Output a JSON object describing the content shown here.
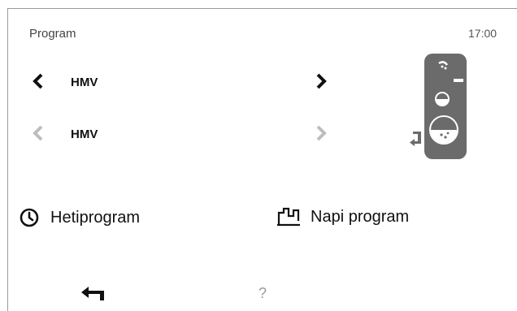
{
  "header": {
    "title": "Program",
    "time": "17:00"
  },
  "rows": [
    {
      "label": "HMV",
      "active": true
    },
    {
      "label": "HMV",
      "active": false
    }
  ],
  "bottom": {
    "weekly": {
      "label": "Hetiprogram",
      "icon": "clock-icon"
    },
    "daily": {
      "label": "Napi program",
      "icon": "daily-chart-icon"
    }
  },
  "footer": {
    "back_icon": "back-arrow-icon",
    "help_label": "?"
  },
  "colors": {
    "active_arrow": "#111111",
    "inactive_arrow": "#bdbdbd",
    "tank": "#6b6b6b"
  }
}
